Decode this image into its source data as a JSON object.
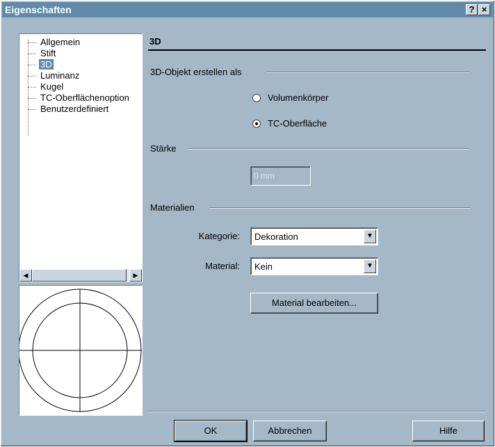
{
  "window": {
    "title": "Eigenschaften",
    "help_label": "?",
    "close_label": "×"
  },
  "tree": {
    "items": [
      {
        "label": "Allgemein"
      },
      {
        "label": "Stift"
      },
      {
        "label": "3D",
        "selected": true
      },
      {
        "label": "Luminanz"
      },
      {
        "label": "Kugel"
      },
      {
        "label": "TC-Oberflächenoption"
      },
      {
        "label": "Benutzerdefiniert"
      }
    ],
    "scroll_left": "◀",
    "scroll_right": "▶"
  },
  "panel": {
    "title": "3D",
    "create_as": {
      "label": "3D-Objekt erstellen als",
      "options": [
        {
          "label": "Volumenkörper",
          "checked": false
        },
        {
          "label": "TC-Oberfläche",
          "checked": true
        }
      ]
    },
    "thickness": {
      "label": "Stärke",
      "value": "0 mm"
    },
    "materials": {
      "label": "Materialien",
      "category_label": "Kategorie:",
      "category_value": "Dekoration",
      "material_label": "Material:",
      "material_value": "Kein",
      "edit_button": "Material bearbeiten..."
    }
  },
  "footer": {
    "ok": "OK",
    "cancel": "Abbrechen",
    "help": "Hilfe"
  }
}
